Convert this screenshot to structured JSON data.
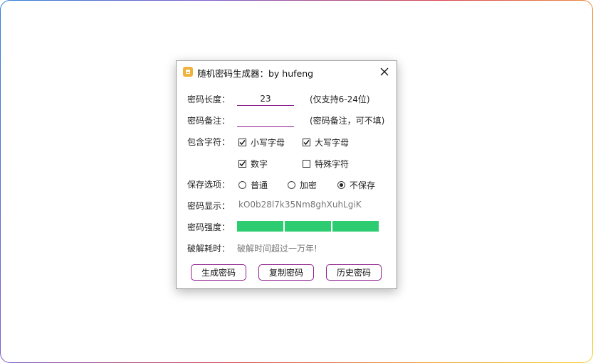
{
  "window": {
    "title": "随机密码生成器：by hufeng",
    "icon": "lock-icon",
    "close_icon": "close-icon"
  },
  "length_row": {
    "label": "密码长度：",
    "value": "23",
    "hint": "(仅支持6-24位)"
  },
  "note_row": {
    "label": "密码备注：",
    "value": "",
    "hint": "(密码备注，可不填)"
  },
  "include_row": {
    "label": "包含字符：",
    "options": [
      {
        "label": "小写字母",
        "checked": true
      },
      {
        "label": "大写字母",
        "checked": true
      },
      {
        "label": "数字",
        "checked": true
      },
      {
        "label": "特殊字符",
        "checked": false
      }
    ]
  },
  "save_row": {
    "label": "保存选项：",
    "options": [
      {
        "label": "普通",
        "selected": false
      },
      {
        "label": "加密",
        "selected": false
      },
      {
        "label": "不保存",
        "selected": true
      }
    ]
  },
  "password_row": {
    "label": "密码显示：",
    "value": "kO0b28l7k35Nm8ghXuhLgiK"
  },
  "strength_row": {
    "label": "密码强度：",
    "level": 3,
    "max_level": 3,
    "color": "#2ecc71"
  },
  "crack_row": {
    "label": "破解耗时：",
    "value": "破解时间超过一万年!"
  },
  "buttons": {
    "generate": "生成密码",
    "copy": "复制密码",
    "history": "历史密码"
  },
  "colors": {
    "accent": "#8e1f8e",
    "strength": "#2ecc71",
    "icon": "#f0b23c"
  }
}
